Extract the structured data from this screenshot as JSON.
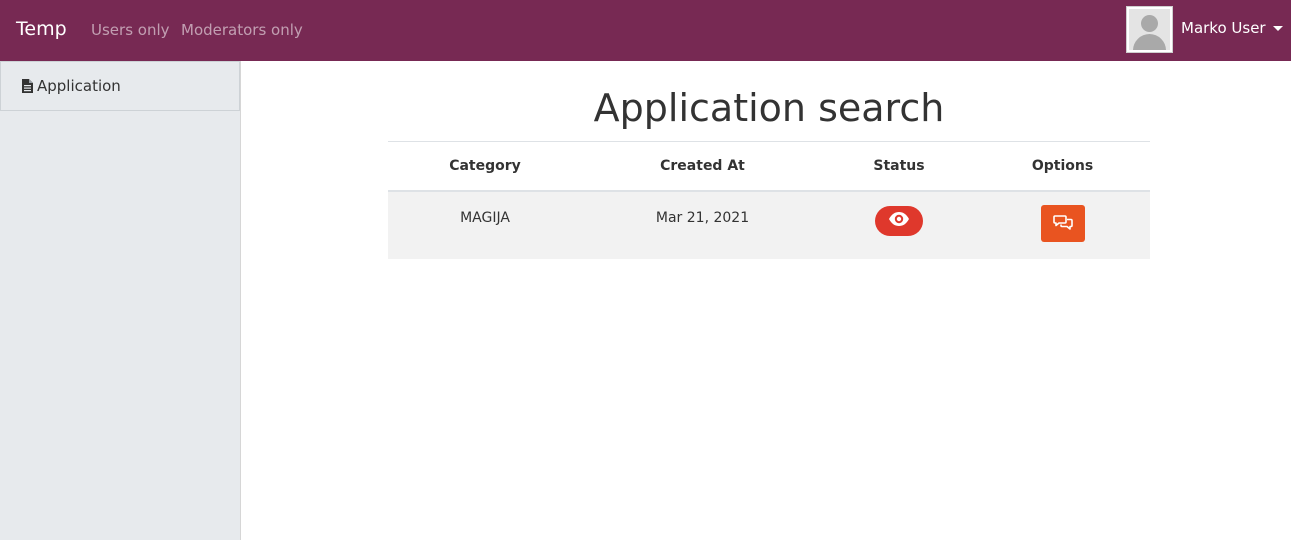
{
  "navbar": {
    "brand": "Temp",
    "links": [
      "Users only",
      "Moderators only"
    ],
    "user_name": "Marko User",
    "color": "#772953"
  },
  "sidebar": {
    "items": [
      {
        "label": "Application",
        "icon": "file-icon"
      }
    ]
  },
  "main": {
    "title": "Application search",
    "table": {
      "headers": [
        "Category",
        "Created At",
        "Status",
        "Options"
      ],
      "rows": [
        {
          "category": "MAGIJA",
          "created_at": "Mar 21, 2021",
          "status_icon": "eye-icon",
          "options_icon": "comments-icon"
        }
      ]
    }
  },
  "colors": {
    "status_button": "#df382c",
    "options_button": "#e95420"
  }
}
